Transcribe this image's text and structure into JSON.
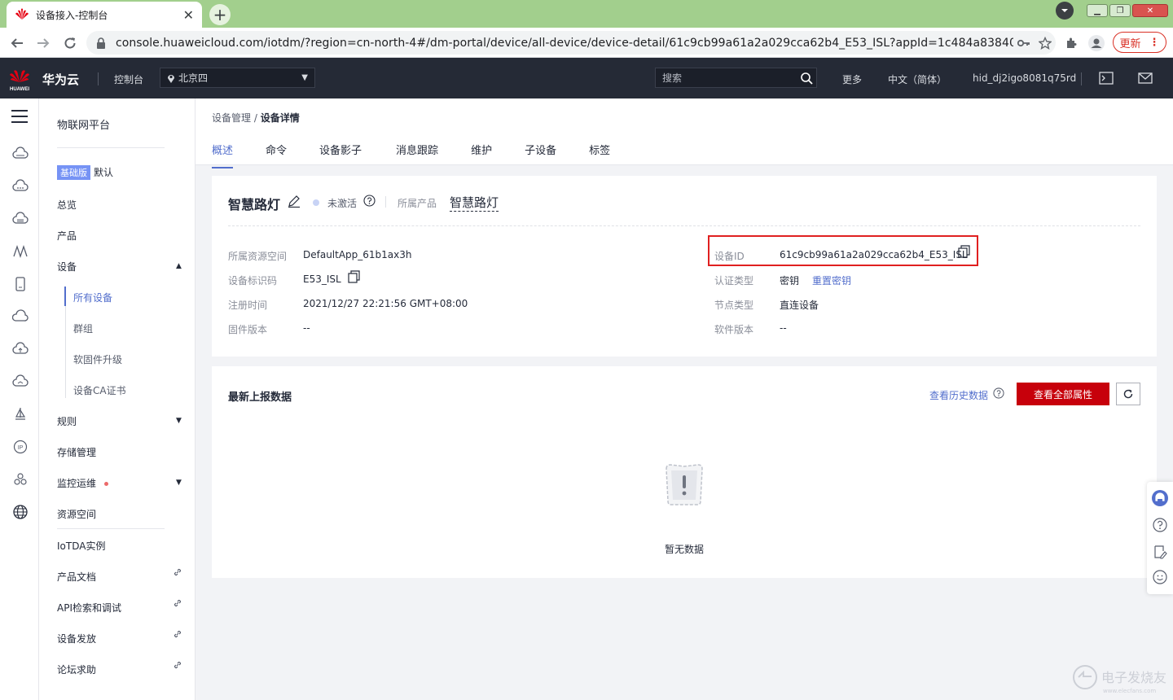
{
  "browser": {
    "tab_title": "设备接入-控制台",
    "url": "console.huaweicloud.com/iotdm/?region=cn-north-4#/dm-portal/device/all-device/device-detail/61c9cb99a61a2a029cca62b4_E53_ISL?appId=1c484a8384024...",
    "update_label": "更新"
  },
  "topbar": {
    "brand": "华为云",
    "logo_text": "HUAWEI",
    "console": "控制台",
    "region": "北京四",
    "search_placeholder": "搜索",
    "more": "更多",
    "language": "中文（简体）",
    "user": "hid_dj2igo8081q75rd"
  },
  "subnav": {
    "title": "物联网平台",
    "edition_badge": "基础版",
    "edition_label": "默认",
    "items": {
      "overview": "总览",
      "product": "产品",
      "device": "设备",
      "all_devices": "所有设备",
      "group": "群组",
      "firmware": "软固件升级",
      "ca": "设备CA证书",
      "rules": "规则",
      "storage": "存储管理",
      "monitor": "监控运维",
      "resource_space": "资源空间",
      "iotda": "IoTDA实例",
      "docs": "产品文档",
      "api": "API检索和调试",
      "provision": "设备发放",
      "forum": "论坛求助"
    }
  },
  "breadcrumb": {
    "parent": "设备管理",
    "sep": " / ",
    "current": "设备详情"
  },
  "tabs": [
    "概述",
    "命令",
    "设备影子",
    "消息跟踪",
    "维护",
    "子设备",
    "标签"
  ],
  "device": {
    "name": "智慧路灯",
    "status": "未激活",
    "product_label": "所属产品",
    "product_value": "智慧路灯",
    "left": [
      {
        "label": "所属资源空间",
        "value": "DefaultApp_61b1ax3h"
      },
      {
        "label": "设备标识码",
        "value": "E53_ISL"
      },
      {
        "label": "注册时间",
        "value": "2021/12/27 22:21:56 GMT+08:00"
      },
      {
        "label": "固件版本",
        "value": "--"
      }
    ],
    "right": [
      {
        "label": "设备ID",
        "value": "61c9cb99a61a2a029cca62b4_E53_ISL"
      },
      {
        "label": "认证类型",
        "value": "密钥",
        "link": "重置密钥"
      },
      {
        "label": "节点类型",
        "value": "直连设备"
      },
      {
        "label": "软件版本",
        "value": "--"
      }
    ]
  },
  "latest": {
    "title": "最新上报数据",
    "history_link": "查看历史数据",
    "view_all_button": "查看全部属性",
    "empty_text": "暂无数据"
  },
  "watermark": "电子发烧友",
  "watermark_url": "www.elecfans.com",
  "colors": {
    "accent": "#526ecc",
    "primary_button": "#c7000b",
    "topbar": "#252a36",
    "highlight_box": "#e02020"
  }
}
